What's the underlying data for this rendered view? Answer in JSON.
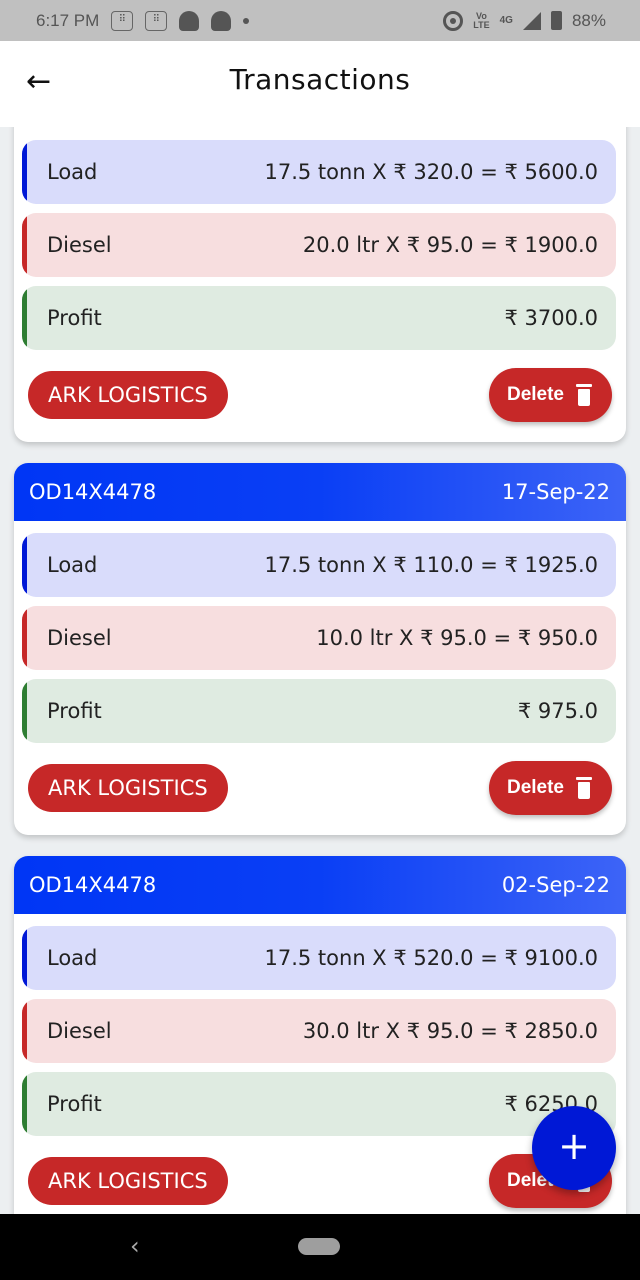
{
  "status_bar": {
    "time": "6:17 PM",
    "network": "4G",
    "volte": "VoLTE",
    "battery": "88%"
  },
  "app_bar": {
    "back_icon": "arrow-left-icon",
    "title": "Transactions"
  },
  "colors": {
    "header_blue": "#0036f5",
    "load_accent": "#0018d6",
    "diesel_accent": "#c62828",
    "profit_accent": "#2e7d32",
    "button_red": "#c62828",
    "fab_blue": "#0018d6"
  },
  "transactions": [
    {
      "vehicle": "",
      "date": "",
      "load_label": "Load",
      "load_value": "17.5 tonn X ₹ 320.0 = ₹ 5600.0",
      "diesel_label": "Diesel",
      "diesel_value": "20.0 ltr X ₹ 95.0 = ₹ 1900.0",
      "profit_label": "Profit",
      "profit_value": "₹ 3700.0",
      "company": "ARK LOGISTICS",
      "delete_label": "Delete"
    },
    {
      "vehicle": "OD14X4478",
      "date": "17-Sep-22",
      "load_label": "Load",
      "load_value": "17.5 tonn X ₹ 110.0 = ₹ 1925.0",
      "diesel_label": "Diesel",
      "diesel_value": "10.0 ltr X ₹ 95.0 = ₹ 950.0",
      "profit_label": "Profit",
      "profit_value": "₹ 975.0",
      "company": "ARK LOGISTICS",
      "delete_label": "Delete"
    },
    {
      "vehicle": "OD14X4478",
      "date": "02-Sep-22",
      "load_label": "Load",
      "load_value": "17.5 tonn X ₹ 520.0 = ₹ 9100.0",
      "diesel_label": "Diesel",
      "diesel_value": "30.0 ltr X ₹ 95.0 = ₹ 2850.0",
      "profit_label": "Profit",
      "profit_value": "₹ 6250.0",
      "company": "ARK LOGISTICS",
      "delete_label": "Delete"
    }
  ],
  "fab": {
    "icon": "plus-icon",
    "label": "+"
  },
  "nav_bar": {
    "back_icon": "chevron-left-icon",
    "home_icon": "home-pill-icon"
  }
}
